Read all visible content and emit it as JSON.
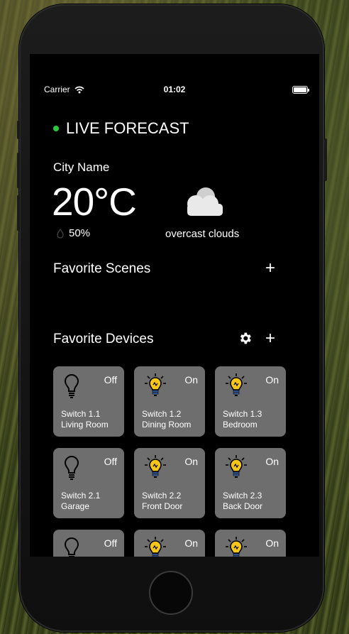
{
  "status_bar": {
    "carrier": "Carrier",
    "time": "01:02"
  },
  "forecast": {
    "live_label": "LIVE FORECAST",
    "city": "City Name",
    "temperature": "20°C",
    "humidity": "50%",
    "condition": "overcast clouds",
    "icon": "cloud-icon"
  },
  "scenes": {
    "title": "Favorite Scenes",
    "add_label": "+"
  },
  "devices": {
    "title": "Favorite Devices",
    "add_label": "+",
    "items": [
      {
        "name": "Switch 1.1",
        "room": "Living Room",
        "state": "Off",
        "icon": "bulb-off-icon"
      },
      {
        "name": "Switch 1.2",
        "room": "Dining Room",
        "state": "On",
        "icon": "bulb-on-icon"
      },
      {
        "name": "Switch 1.3",
        "room": "Bedroom",
        "state": "On",
        "icon": "bulb-on-icon"
      },
      {
        "name": "Switch 2.1",
        "room": "Garage",
        "state": "Off",
        "icon": "bulb-off-icon"
      },
      {
        "name": "Switch 2.2",
        "room": "Front Door",
        "state": "On",
        "icon": "bulb-on-icon"
      },
      {
        "name": "Switch 2.3",
        "room": "Back Door",
        "state": "On",
        "icon": "bulb-on-icon"
      },
      {
        "name": "",
        "room": "",
        "state": "Off",
        "icon": "bulb-off-icon"
      },
      {
        "name": "",
        "room": "",
        "state": "On",
        "icon": "bulb-on-icon"
      },
      {
        "name": "",
        "room": "",
        "state": "On",
        "icon": "bulb-on-icon"
      }
    ]
  },
  "colors": {
    "live_dot": "#28c840",
    "tile": "#6e6e6e",
    "bulb_on": "#f5c518"
  }
}
